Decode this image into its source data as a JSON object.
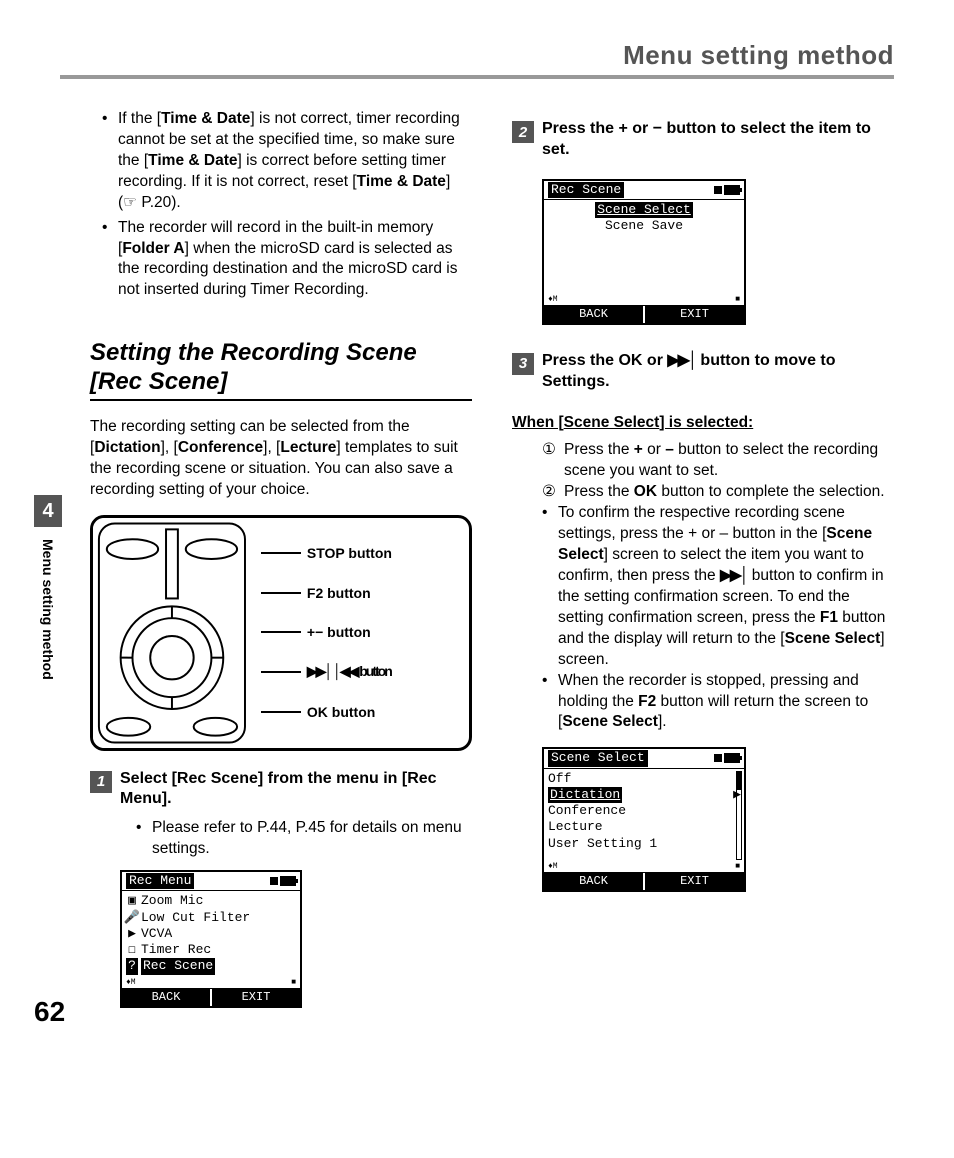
{
  "header": {
    "title": "Menu setting method"
  },
  "tab": {
    "chapter": "4",
    "label": "Menu setting method"
  },
  "page_number": "62",
  "left": {
    "notes": {
      "n1_pre": "If the [",
      "n1_b1": "Time & Date",
      "n1_mid1": "] is not correct, timer recording cannot be set at the specified time, so make sure the [",
      "n1_b2": "Time & Date",
      "n1_mid2": "] is correct before setting timer recording. If it is not correct, reset [",
      "n1_b3": "Time & Date",
      "n1_post": "] (☞ P.20).",
      "n2_pre": "The recorder will record in the built-in memory [",
      "n2_b1": "Folder A",
      "n2_post": "] when the microSD card is selected as the recording destination and the microSD card is not inserted during Timer Recording."
    },
    "heading": "Setting the Recording Scene [Rec Scene]",
    "intro_pre": "The recording setting can be selected from the [",
    "intro_b1": "Dictation",
    "intro_m1": "], [",
    "intro_b2": "Conference",
    "intro_m2": "], [",
    "intro_b3": "Lecture",
    "intro_post": "] templates to suit the recording scene or situation. You can also save a recording setting of your choice.",
    "diagram": {
      "l1": "STOP button",
      "l2": "F2 button",
      "l3": "+− button",
      "l4a": "▶▶│ │◀◀ button",
      "l5": "OK button"
    },
    "step1": {
      "num": "1",
      "pre": "Select [",
      "b1": "Rec Scene",
      "mid": "] from the menu in [",
      "b2": "Rec Menu",
      "post": "].",
      "sub": "Please refer to P.44, P.45 for details on menu settings."
    },
    "lcd1": {
      "title": "Rec Menu",
      "items": [
        "Zoom Mic",
        "Low Cut Filter",
        "VCVA",
        "Timer Rec"
      ],
      "selected": "Rec Scene",
      "foot_left": "BACK",
      "foot_right": "EXIT"
    }
  },
  "right": {
    "step2": {
      "num": "2",
      "pre": "Press the ",
      "b1": "+",
      "mid": " or ",
      "b2": "−",
      "post": " button to select the item to set."
    },
    "lcd2": {
      "title": "Rec Scene",
      "selected": "Scene Select",
      "item": "Scene Save",
      "foot_left": "BACK",
      "foot_right": "EXIT"
    },
    "step3": {
      "num": "3",
      "pre": "Press the ",
      "b1": "OK",
      "mid": " or ",
      "icon": "▶▶│",
      "post": " button to move to Settings."
    },
    "when_pre": "When [",
    "when_b": "Scene Select",
    "when_post": "] is selected:",
    "circ1_pre": "Press the ",
    "circ1_b1": "+",
    "circ1_mid": " or ",
    "circ1_b2": "–",
    "circ1_post": " button to select the recording scene you want to set.",
    "circ2_pre": "Press the ",
    "circ2_b": "OK",
    "circ2_post": " button to complete the selection.",
    "b1_pre": "To confirm the respective recording scene settings, press the + or – button in the [",
    "b1_b1": "Scene Select",
    "b1_mid1": "] screen to select the item you want to confirm, then press the ",
    "b1_icon": "▶▶│",
    "b1_mid2": " button to confirm in the setting confirmation screen. To end the setting confirmation screen, press the ",
    "b1_b2": "F1",
    "b1_mid3": " button and the display will return to the [",
    "b1_b3": "Scene Select",
    "b1_post": "] screen.",
    "b2_pre": "When the recorder is stopped, pressing and holding the ",
    "b2_b1": "F2",
    "b2_mid": " button will return the screen to [",
    "b2_b2": "Scene Select",
    "b2_post": "].",
    "lcd3": {
      "title": "Scene Select",
      "items_top": [
        "Off"
      ],
      "selected": "Dictation",
      "items_bot": [
        "Conference",
        "Lecture",
        "User Setting 1"
      ],
      "foot_left": "BACK",
      "foot_right": "EXIT"
    }
  }
}
